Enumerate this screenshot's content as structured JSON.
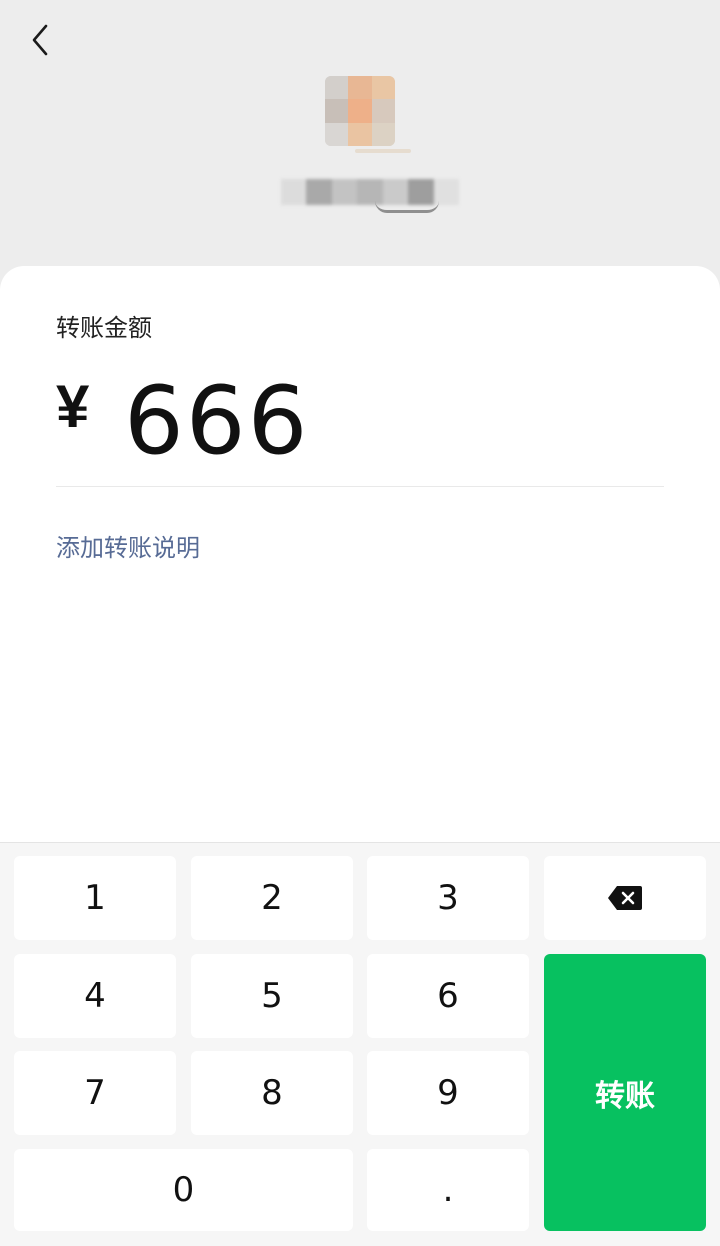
{
  "header": {
    "back_icon": "chevron-left-icon"
  },
  "amount": {
    "label": "转账金额",
    "currency": "¥",
    "value": "666"
  },
  "add_note_label": "添加转账说明",
  "keypad": {
    "keys": [
      "1",
      "2",
      "3",
      "4",
      "5",
      "6",
      "7",
      "8",
      "9",
      "0",
      "."
    ],
    "backspace_icon": "backspace-icon",
    "transfer_label": "转账"
  },
  "colors": {
    "accent_green": "#07c160",
    "link_blue": "#576b95"
  }
}
